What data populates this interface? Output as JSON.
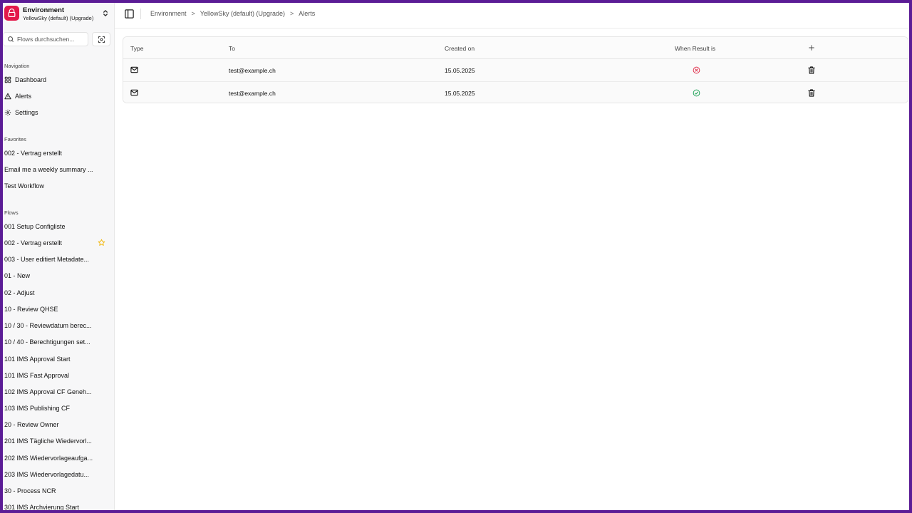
{
  "environment": {
    "title": "Environment",
    "subtitle": "YellowSky (default) (Upgrade)"
  },
  "search": {
    "placeholder": "Flows durchsuchen..."
  },
  "navigation": {
    "label": "Navigation",
    "items": [
      {
        "label": "Dashboard",
        "icon": "dashboard-icon"
      },
      {
        "label": "Alerts",
        "icon": "alert-triangle-icon"
      },
      {
        "label": "Settings",
        "icon": "gear-icon"
      }
    ]
  },
  "favorites": {
    "label": "Favorites",
    "items": [
      "002 - Vertrag erstellt",
      "Email me a weekly summary ...",
      "Test Workflow"
    ]
  },
  "flows": {
    "label": "Flows",
    "items": [
      "001 Setup Configliste",
      "002 - Vertrag erstellt",
      "003 - User editiert Metadate...",
      "01 - New",
      "02 - Adjust",
      "10 - Review QHSE",
      "10 / 30 - Reviewdatum berec...",
      "10 / 40 - Berechtigungen set...",
      "101 IMS Approval Start",
      "101 IMS Fast Approval",
      "102 IMS Approval CF Geneh...",
      "103 IMS Publishing CF",
      "20 - Review Owner",
      "201 IMS Tägliche Wiedervorl...",
      "202 IMS Wiedervorlageaufga...",
      "203 IMS Wiedervorlagedatu...",
      "30 - Process NCR",
      "301 IMS Archvierung Start"
    ]
  },
  "breadcrumb": [
    "Environment",
    "YellowSky (default) (Upgrade)",
    "Alerts"
  ],
  "table": {
    "columns": [
      "Type",
      "To",
      "Created on",
      "When Result is"
    ],
    "rows": [
      {
        "type_icon": "mail-icon",
        "to": "test@example.ch",
        "created_on": "15.05.2025",
        "result": "failure",
        "result_icon": "x-circle-icon"
      },
      {
        "type_icon": "mail-icon",
        "to": "test@example.ch",
        "created_on": "15.05.2025",
        "result": "success",
        "result_icon": "check-circle-icon"
      }
    ]
  },
  "colors": {
    "accent": "#e3194a",
    "frame": "#5b1c96",
    "success": "#22a35a",
    "failure": "#e0344f",
    "star": "#f2b400"
  }
}
